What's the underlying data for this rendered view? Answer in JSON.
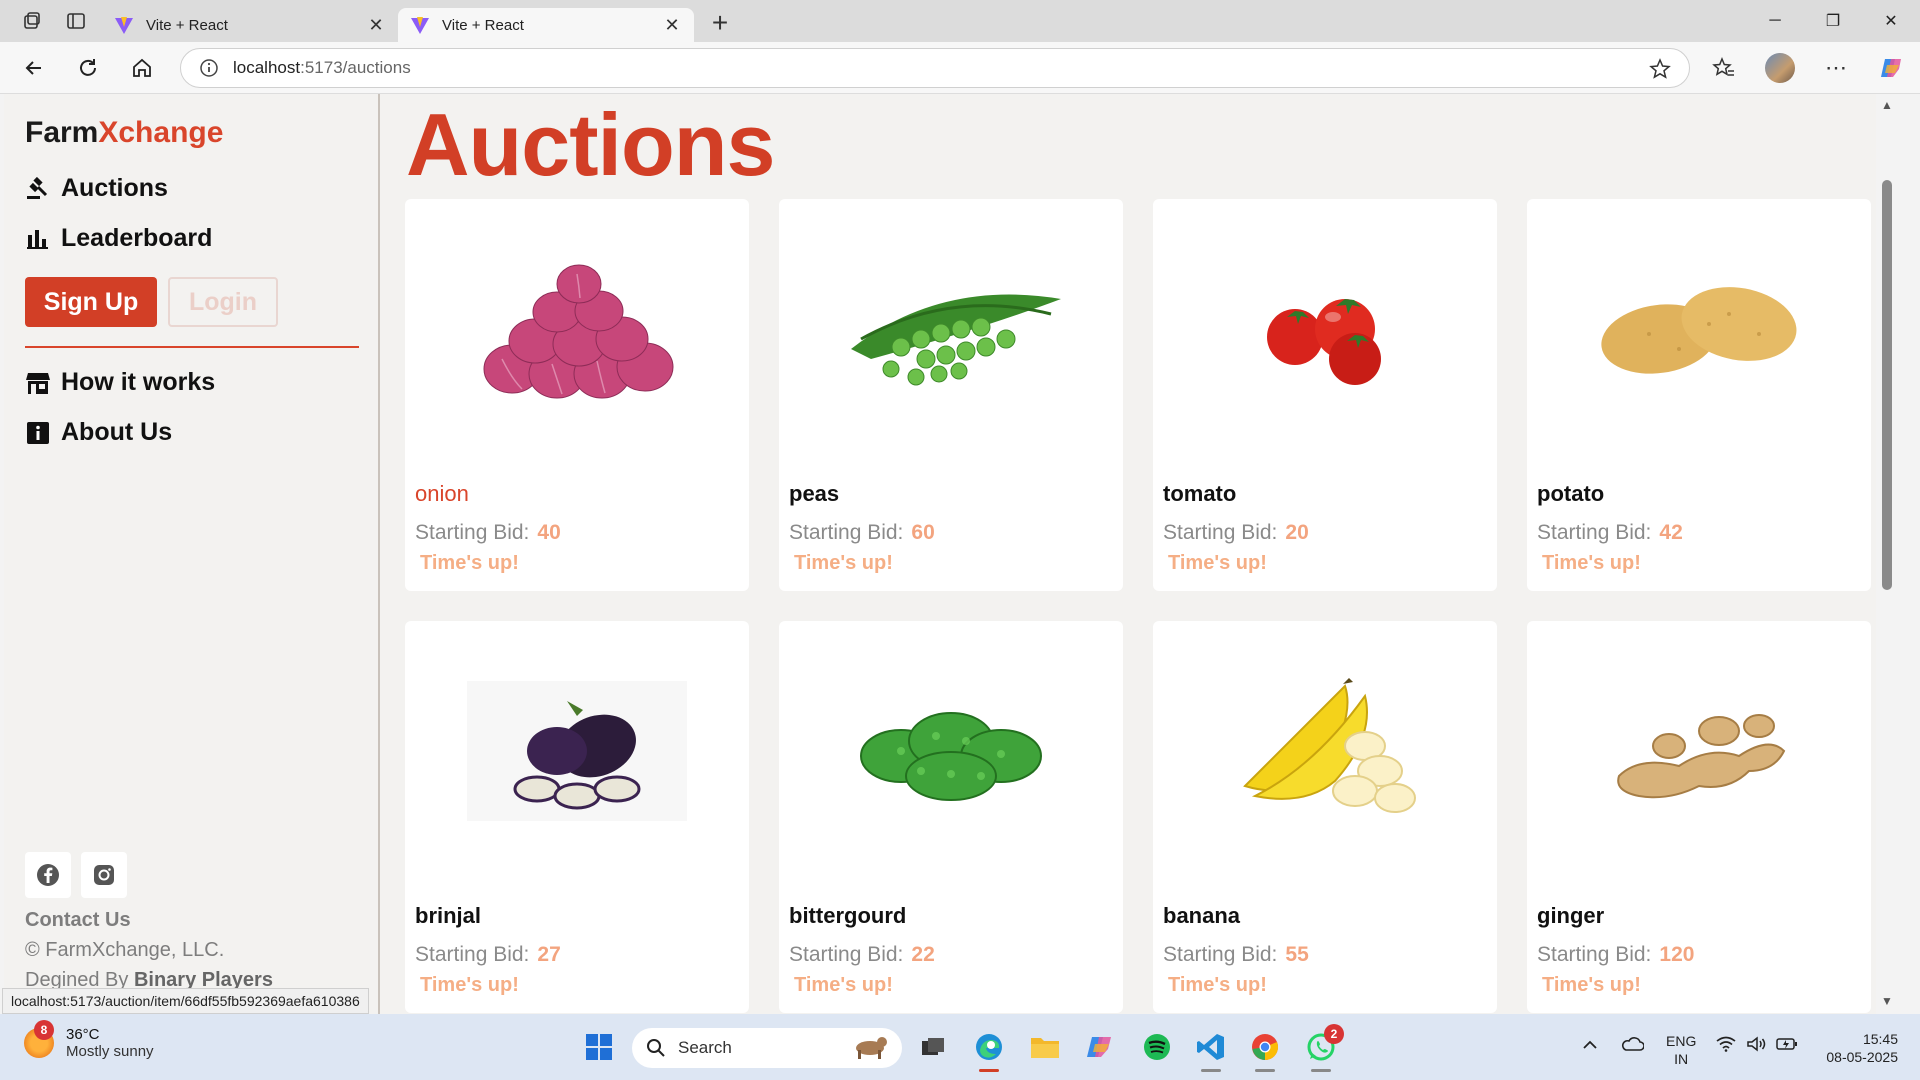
{
  "browser": {
    "tabs": [
      {
        "title": "Vite + React",
        "active": false
      },
      {
        "title": "Vite + React",
        "active": true
      }
    ],
    "url_host": "localhost",
    "url_path": ":5173/auctions",
    "status_url": "localhost:5173/auction/item/66df55fb592369aefa610386"
  },
  "sidebar": {
    "brand_part1": "Farm",
    "brand_part2": "Xchange",
    "nav": [
      {
        "label": "Auctions",
        "icon": "gavel-icon"
      },
      {
        "label": "Leaderboard",
        "icon": "bar-chart-icon"
      }
    ],
    "signup_label": "Sign Up",
    "login_label": "Login",
    "nav2": [
      {
        "label": "How it works",
        "icon": "store-icon"
      },
      {
        "label": "About Us",
        "icon": "info-icon"
      }
    ],
    "social": [
      "facebook-icon",
      "instagram-icon"
    ],
    "contact_label": "Contact Us",
    "copyright": "© FarmXchange, LLC.",
    "designed_prefix": "Degined By ",
    "designed_by": "Binary Players"
  },
  "page": {
    "title": "Auctions",
    "bid_label": "Starting Bid:",
    "timeup_label": "Time's up!"
  },
  "auctions": [
    {
      "name": "onion",
      "bid": "40",
      "image": "onion"
    },
    {
      "name": "peas",
      "bid": "60",
      "image": "peas"
    },
    {
      "name": "tomato",
      "bid": "20",
      "image": "tomato"
    },
    {
      "name": "potato",
      "bid": "42",
      "image": "potato"
    },
    {
      "name": "brinjal",
      "bid": "27",
      "image": "brinjal"
    },
    {
      "name": "bittergourd",
      "bid": "22",
      "image": "bittergourd"
    },
    {
      "name": "banana",
      "bid": "55",
      "image": "banana"
    },
    {
      "name": "ginger",
      "bid": "120",
      "image": "ginger"
    }
  ],
  "taskbar": {
    "weather_badge": "8",
    "temperature": "36°C",
    "weather": "Mostly sunny",
    "search_label": "Search",
    "whatsapp_badge": "2",
    "lang_line1": "ENG",
    "lang_line2": "IN",
    "time": "15:45",
    "date": "08-05-2025"
  },
  "colors": {
    "accent": "#d23f26",
    "bid_amount": "#f3a47f",
    "timeup": "#f5ae85"
  }
}
